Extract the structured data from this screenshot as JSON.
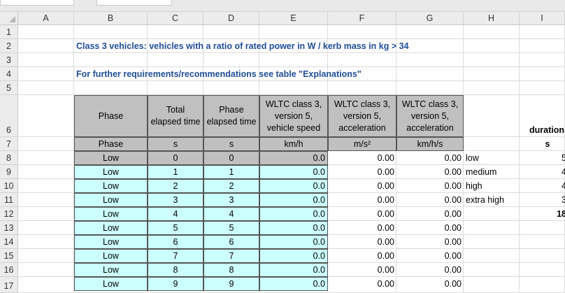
{
  "columns": [
    "A",
    "B",
    "C",
    "D",
    "E",
    "F",
    "G",
    "H",
    "I"
  ],
  "rows": [
    "1",
    "2",
    "3",
    "4",
    "5",
    "6",
    "7",
    "8",
    "9",
    "10",
    "11",
    "12",
    "13",
    "14",
    "15",
    "16",
    "17"
  ],
  "title_row2": "Class 3 vehicles:  vehicles with a ratio of rated power in W / kerb mass in kg  > 34",
  "title_row4": "For further requirements/recommendations see table \"Explanations\"",
  "header": {
    "phase": [
      "Phase"
    ],
    "total_elapsed": [
      "Total",
      "elapsed time"
    ],
    "phase_elapsed": [
      "Phase",
      "elapsed time"
    ],
    "speed": [
      "WLTC class 3,",
      "version 5,",
      "vehicle speed"
    ],
    "accel1": [
      "WLTC class 3,",
      "version 5,",
      "acceleration"
    ],
    "accel2": [
      "WLTC class 3,",
      "version 5,",
      "acceleration"
    ]
  },
  "units": {
    "phase": "Phase",
    "total_elapsed": "s",
    "phase_elapsed": "s",
    "speed": "km/h",
    "accel1": "m/s²",
    "accel2": "km/h/s"
  },
  "data_rows": [
    {
      "phase": "Low",
      "total": "0",
      "phase_time": "0",
      "speed": "0.0",
      "accel1": "0.00",
      "accel2": "0.00",
      "h": "low",
      "i": "5"
    },
    {
      "phase": "Low",
      "total": "1",
      "phase_time": "1",
      "speed": "0.0",
      "accel1": "0.00",
      "accel2": "0.00",
      "h": "medium",
      "i": "4"
    },
    {
      "phase": "Low",
      "total": "2",
      "phase_time": "2",
      "speed": "0.0",
      "accel1": "0.00",
      "accel2": "0.00",
      "h": "high",
      "i": "4"
    },
    {
      "phase": "Low",
      "total": "3",
      "phase_time": "3",
      "speed": "0.0",
      "accel1": "0.00",
      "accel2": "0.00",
      "h": "extra high",
      "i": "3"
    },
    {
      "phase": "Low",
      "total": "4",
      "phase_time": "4",
      "speed": "0.0",
      "accel1": "0.00",
      "accel2": "0.00",
      "h": "",
      "i": "18"
    },
    {
      "phase": "Low",
      "total": "5",
      "phase_time": "5",
      "speed": "0.0",
      "accel1": "0.00",
      "accel2": "0.00",
      "h": "",
      "i": ""
    },
    {
      "phase": "Low",
      "total": "6",
      "phase_time": "6",
      "speed": "0.0",
      "accel1": "0.00",
      "accel2": "0.00",
      "h": "",
      "i": ""
    },
    {
      "phase": "Low",
      "total": "7",
      "phase_time": "7",
      "speed": "0.0",
      "accel1": "0.00",
      "accel2": "0.00",
      "h": "",
      "i": ""
    },
    {
      "phase": "Low",
      "total": "8",
      "phase_time": "8",
      "speed": "0.0",
      "accel1": "0.00",
      "accel2": "0.00",
      "h": "",
      "i": ""
    },
    {
      "phase": "Low",
      "total": "9",
      "phase_time": "9",
      "speed": "0.0",
      "accel1": "0.00",
      "accel2": "0.00",
      "h": "",
      "i": ""
    }
  ],
  "col_i": {
    "row6": "duration",
    "row7": "s"
  },
  "colors": {
    "header_gray": "#c0c0c0",
    "data_cyan": "#ccffff",
    "title_blue": "#1f4e9a"
  }
}
